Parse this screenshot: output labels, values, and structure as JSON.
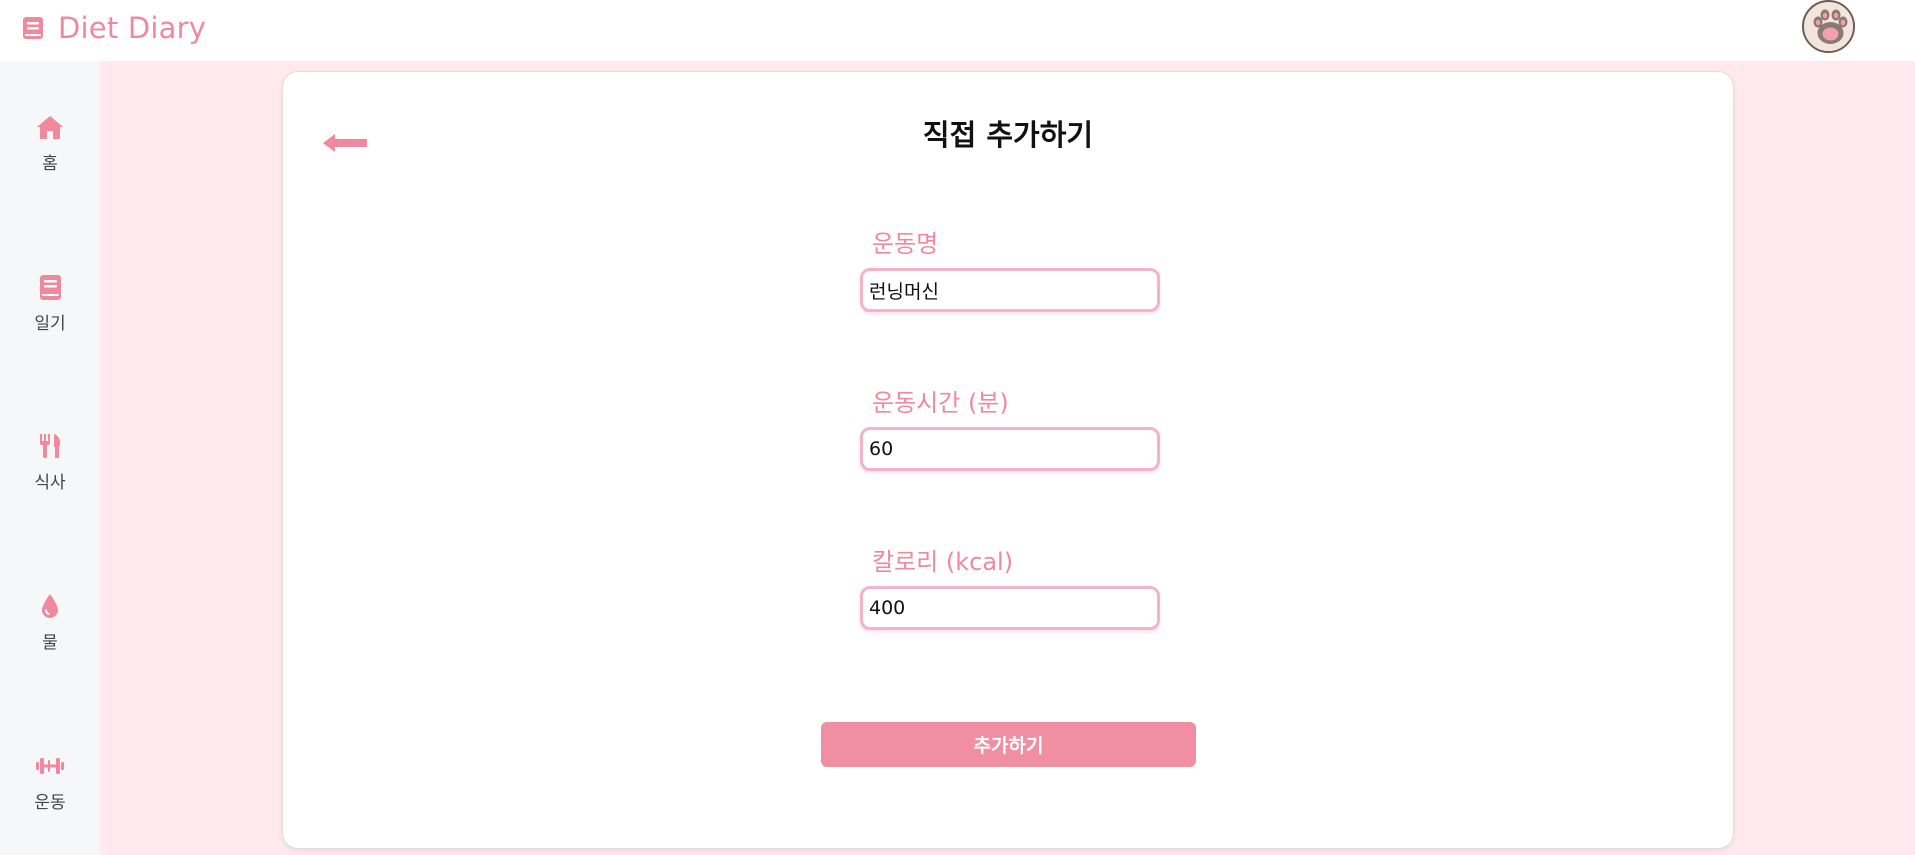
{
  "app": {
    "brand": "Diet Diary",
    "brand_icon": "book-icon",
    "accent_color": "#f0889e",
    "avatar_icon": "cat-paw-avatar"
  },
  "sidebar": {
    "items": [
      {
        "label": "홈",
        "icon": "home-icon"
      },
      {
        "label": "일기",
        "icon": "book-icon"
      },
      {
        "label": "식사",
        "icon": "utensils-icon"
      },
      {
        "label": "물",
        "icon": "water-drop-icon"
      },
      {
        "label": "운동",
        "icon": "dumbbell-icon"
      }
    ]
  },
  "form": {
    "title": "직접 추가하기",
    "back_icon": "arrow-left-icon",
    "fields": [
      {
        "label": "운동명",
        "value": "런닝머신"
      },
      {
        "label": "운동시간 (분)",
        "value": "60"
      },
      {
        "label": "칼로리 (kcal)",
        "value": "400"
      }
    ],
    "submit_label": "추가하기"
  }
}
